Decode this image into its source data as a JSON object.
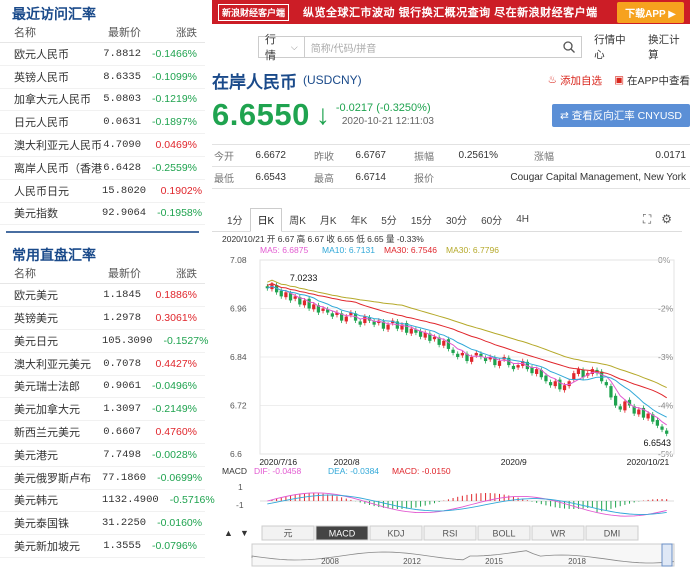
{
  "recent": {
    "title": "最近访问汇率",
    "headers": [
      "名称",
      "最新价",
      "涨跌"
    ],
    "rows": [
      {
        "name": "欧元人民币",
        "price": "7.8812",
        "chg": "-0.1466%",
        "dir": "dn"
      },
      {
        "name": "英镑人民币",
        "price": "8.6335",
        "chg": "-0.1099%",
        "dir": "dn"
      },
      {
        "name": "加拿大元人民币",
        "price": "5.0803",
        "chg": "-0.1219%",
        "dir": "dn"
      },
      {
        "name": "日元人民币",
        "price": "0.0631",
        "chg": "-0.1897%",
        "dir": "dn"
      },
      {
        "name": "澳大利亚元人民币",
        "price": "4.7090",
        "chg": "0.0469%",
        "dir": "up"
      },
      {
        "name": "离岸人民币（香港）",
        "price": "6.6428",
        "chg": "-0.2559%",
        "dir": "dn"
      },
      {
        "name": "人民币日元",
        "price": "15.8020",
        "chg": "0.1902%",
        "dir": "up"
      },
      {
        "name": "美元指数",
        "price": "92.9064",
        "chg": "-0.1958%",
        "dir": "dn"
      }
    ]
  },
  "direct": {
    "title": "常用直盘汇率",
    "headers": [
      "名称",
      "最新价",
      "涨跌"
    ],
    "rows": [
      {
        "name": "欧元美元",
        "price": "1.1845",
        "chg": "0.1886%",
        "dir": "up"
      },
      {
        "name": "英镑美元",
        "price": "1.2978",
        "chg": "0.3061%",
        "dir": "up"
      },
      {
        "name": "美元日元",
        "price": "105.3090",
        "chg": "-0.1527%",
        "dir": "dn"
      },
      {
        "name": "澳大利亚元美元",
        "price": "0.7078",
        "chg": "0.4427%",
        "dir": "up"
      },
      {
        "name": "美元瑞士法郎",
        "price": "0.9061",
        "chg": "-0.0496%",
        "dir": "dn"
      },
      {
        "name": "美元加拿大元",
        "price": "1.3097",
        "chg": "-0.2149%",
        "dir": "dn"
      },
      {
        "name": "新西兰元美元",
        "price": "0.6607",
        "chg": "0.4760%",
        "dir": "up"
      },
      {
        "name": "美元港元",
        "price": "7.7498",
        "chg": "-0.0028%",
        "dir": "dn"
      },
      {
        "name": "美元俄罗斯卢布",
        "price": "77.1860",
        "chg": "-0.0699%",
        "dir": "dn"
      },
      {
        "name": "美元韩元",
        "price": "1132.4900",
        "chg": "-0.5716%",
        "dir": "dn"
      },
      {
        "name": "美元泰国铢",
        "price": "31.2250",
        "chg": "-0.0160%",
        "dir": "dn"
      },
      {
        "name": "美元新加坡元",
        "price": "1.3555",
        "chg": "-0.0796%",
        "dir": "dn"
      }
    ]
  },
  "banner": {
    "logo": "新浪财经客户端",
    "text": "纵览全球汇市波动  银行换汇概况查询  尽在新浪财经客户端",
    "download": "下载APP ▶"
  },
  "search": {
    "category": "行情",
    "placeholder": "简称/代码/拼音",
    "link1": "行情中心",
    "link2": "换汇计算"
  },
  "title": {
    "name": "在岸人民币",
    "code": "(USDCNY)",
    "add": "添加自选",
    "app": "在APP中查看"
  },
  "price": {
    "value": "6.6550",
    "change": "-0.0217 (-0.3250%)",
    "time": "2020-10-21 12:11:03",
    "reverse_btn": "查看反向汇率 CNYUSD"
  },
  "quote": {
    "row1": [
      {
        "label": "今开",
        "value": "6.6672"
      },
      {
        "label": "昨收",
        "value": "6.6767"
      },
      {
        "label": "振幅",
        "value": "0.2561%"
      },
      {
        "label": "涨幅",
        "value": "0.0171"
      }
    ],
    "row2": [
      {
        "label": "最低",
        "value": "6.6543"
      },
      {
        "label": "最高",
        "value": "6.6714"
      },
      {
        "label": "报价",
        "value": "Cougar Capital Management, New York"
      }
    ]
  },
  "tabs": [
    "1分",
    "日K",
    "周K",
    "月K",
    "年K",
    "5分",
    "15分",
    "30分",
    "60分",
    "4H"
  ],
  "active_tab": "日K",
  "chart_data": {
    "type": "candlestick",
    "info_line": "2020/10/21 开 6.67 高 6.67 收 6.65 低 6.65 量 -0.33%",
    "ma": {
      "MA5": "6.6875",
      "MA10": "6.7131",
      "MA30": "6.7546",
      "MA30b": "6.7796"
    },
    "ma_colors": {
      "MA5": "#e25ad1",
      "MA10": "#31a8d8",
      "MA30": "#e0262c",
      "MA30b": "#b5a92a"
    },
    "y_ticks": [
      "7.08",
      "6.96",
      "6.84",
      "6.72",
      "6.6"
    ],
    "pct_ticks": [
      "0%",
      "-2%",
      "-3%",
      "-4%",
      "-5%"
    ],
    "ylim": [
      6.6,
      7.08
    ],
    "high_label": "7.0233",
    "low_label": "6.6543",
    "x_labels": [
      "2020/7/16",
      "2020/8",
      "2020/9",
      "2020/10/21"
    ],
    "close": [
      7.01,
      7.02,
      7.0,
      6.99,
      7.0,
      6.98,
      6.99,
      6.97,
      6.98,
      6.96,
      6.97,
      6.95,
      6.96,
      6.95,
      6.94,
      6.95,
      6.93,
      6.94,
      6.95,
      6.93,
      6.92,
      6.94,
      6.93,
      6.92,
      6.93,
      6.91,
      6.92,
      6.93,
      6.91,
      6.92,
      6.9,
      6.91,
      6.9,
      6.89,
      6.9,
      6.88,
      6.89,
      6.87,
      6.88,
      6.86,
      6.85,
      6.84,
      6.85,
      6.83,
      6.84,
      6.85,
      6.84,
      6.83,
      6.84,
      6.82,
      6.83,
      6.84,
      6.82,
      6.81,
      6.82,
      6.83,
      6.81,
      6.8,
      6.81,
      6.79,
      6.78,
      6.77,
      6.78,
      6.76,
      6.77,
      6.78,
      6.8,
      6.81,
      6.79,
      6.8,
      6.81,
      6.8,
      6.78,
      6.77,
      6.74,
      6.72,
      6.71,
      6.73,
      6.72,
      6.7,
      6.71,
      6.69,
      6.7,
      6.68,
      6.67,
      6.66,
      6.65
    ],
    "macd": {
      "label": "MACD",
      "DIF": "-0.0458",
      "DEA": "-0.0384",
      "MACD": "-0.0150"
    },
    "indicator_tabs": [
      "元",
      "MACD",
      "KDJ",
      "RSI",
      "BOLL",
      "WR",
      "DMI"
    ],
    "active_indicator": "MACD",
    "macd_ticks": [
      "1",
      "-1"
    ],
    "timeline_years": [
      "2008",
      "2012",
      "2015",
      "2018"
    ]
  }
}
